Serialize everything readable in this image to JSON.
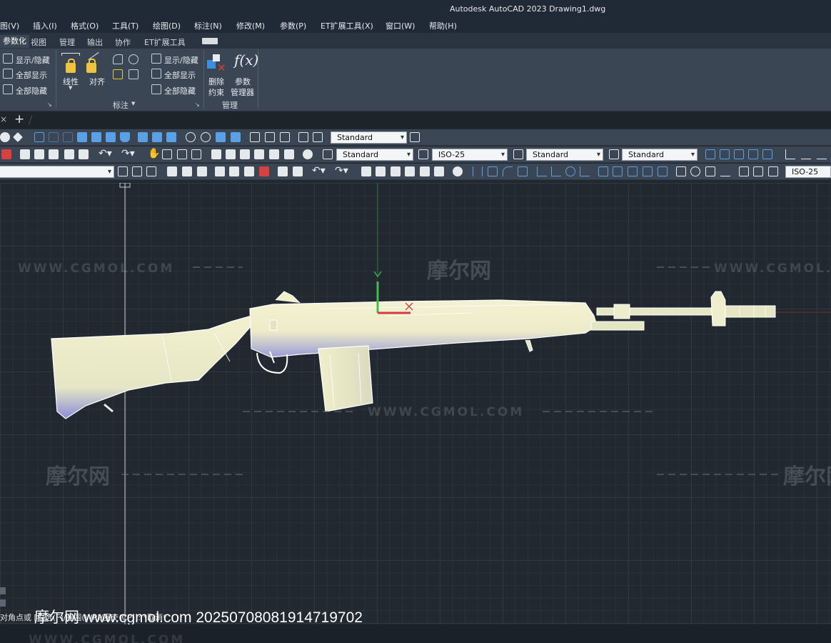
{
  "title_bar": {
    "title": "Autodesk AutoCAD 2023    Drawing1.dwg"
  },
  "menu": [
    "图(V)",
    "插入(I)",
    "格式(O)",
    "工具(T)",
    "绘图(D)",
    "标注(N)",
    "修改(M)",
    "参数(P)",
    "ET扩展工具(X)",
    "窗口(W)",
    "帮助(H)"
  ],
  "ribbon_tabs": [
    "参数化",
    "视图",
    "管理",
    "输出",
    "协作",
    "ET扩展工具"
  ],
  "ribbon": {
    "geo_show_hide": "显示/隐藏",
    "geo_show_all": "全部显示",
    "geo_hide_all": "全部隐藏",
    "linear": "线性",
    "aligned": "对齐",
    "dim_show_hide": "显示/隐藏",
    "dim_show_all": "全部显示",
    "dim_hide_all": "全部隐藏",
    "delete_constraints_1": "删除",
    "delete_constraints_2": "约束",
    "param_manager_1": "参数",
    "param_manager_2": "管理器",
    "fx": "f(x)",
    "panel_dimension": "标注",
    "panel_manage": "管理"
  },
  "toolbars": {
    "row1_combo": "Standard",
    "text_style": "Standard",
    "dim_style": "ISO-25",
    "table_style": "Standard",
    "mleader_style": "Standard",
    "row3_right_combo": "ISO-25"
  },
  "canvas": {
    "watermark_url": "WWW.CGMOL.COM",
    "watermark_brand": "摩尔网",
    "command_prompt": "对角点或 [栏选(F)/圈围(WP)/圈交(CP)]: *取消*",
    "overlay": "摩尔网 www.cgmol.com 20250708081914719702"
  },
  "colors": {
    "canvas_bg": "#212830",
    "ribbon_bg": "#3b4654",
    "model_fill": "#efefc8",
    "model_shadow": "#8d8fd6",
    "ucs_x": "#d23c3c",
    "ucs_y": "#3fbf4a"
  }
}
